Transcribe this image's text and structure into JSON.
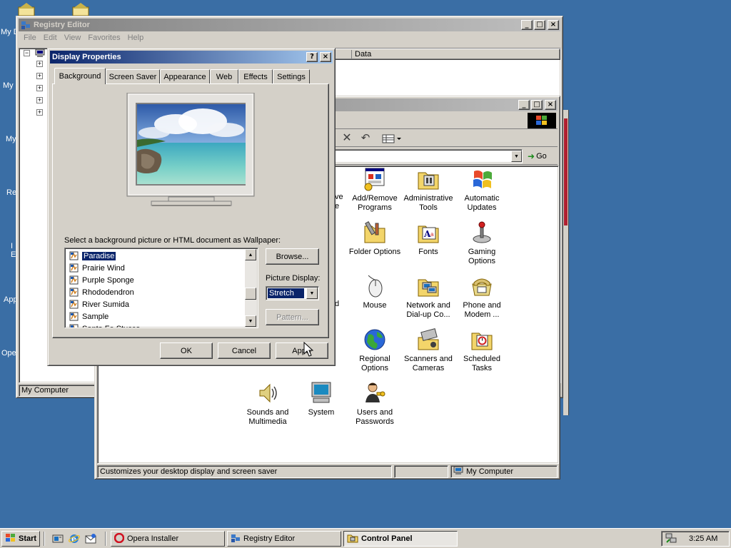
{
  "desktop": {
    "icon_labels": [
      "My D",
      "My",
      "My",
      "Re",
      "I\nE",
      "App",
      "Ope"
    ]
  },
  "registry": {
    "title": "Registry Editor",
    "menu": [
      "File",
      "Edit",
      "View",
      "Favorites",
      "Help"
    ],
    "data_header": "Data",
    "status": "My Computer"
  },
  "control_panel": {
    "go_label": "Go",
    "status_left": "Customizes your desktop display and screen saver",
    "status_right": "My Computer",
    "partial_items": [
      "ve",
      "e",
      "d"
    ],
    "items": [
      {
        "label": "Add/Remove\nPrograms",
        "icon": "add-remove-programs-icon"
      },
      {
        "label": "Administrative\nTools",
        "icon": "administrative-tools-icon"
      },
      {
        "label": "Automatic\nUpdates",
        "icon": "automatic-updates-icon"
      },
      {
        "label": "Folder Options",
        "icon": "folder-options-icon"
      },
      {
        "label": "Fonts",
        "icon": "fonts-icon"
      },
      {
        "label": "Gaming\nOptions",
        "icon": "gaming-options-icon"
      },
      {
        "label": "Mouse",
        "icon": "mouse-icon"
      },
      {
        "label": "Network and\nDial-up Co...",
        "icon": "network-icon"
      },
      {
        "label": "Phone and\nModem ...",
        "icon": "phone-modem-icon"
      },
      {
        "label": "Regional\nOptions",
        "icon": "regional-options-icon"
      },
      {
        "label": "Scanners and\nCameras",
        "icon": "scanner-icon"
      },
      {
        "label": "Scheduled\nTasks",
        "icon": "scheduled-tasks-icon"
      },
      {
        "label": "Sounds and\nMultimedia",
        "icon": "sounds-icon"
      },
      {
        "label": "System",
        "icon": "system-icon"
      },
      {
        "label": "Users and\nPasswords",
        "icon": "users-icon"
      }
    ]
  },
  "display_properties": {
    "title": "Display Properties",
    "tabs": [
      "Background",
      "Screen Saver",
      "Appearance",
      "Web",
      "Effects",
      "Settings"
    ],
    "active_tab": "Background",
    "wallpaper_prompt": "Select a background picture or HTML document as Wallpaper:",
    "wallpapers": [
      "Paradise",
      "Prairie Wind",
      "Purple Sponge",
      "Rhododendron",
      "River Sumida",
      "Sample",
      "Santa Fe Stucco"
    ],
    "selected_wallpaper": "Paradise",
    "browse_label": "Browse...",
    "picture_display_label": "Picture Display:",
    "picture_display_value": "Stretch",
    "pattern_label": "Pattern...",
    "ok_label": "OK",
    "cancel_label": "Cancel",
    "apply_label": "Apply"
  },
  "taskbar": {
    "start_label": "Start",
    "tasks": [
      "Opera Installer",
      "Registry Editor",
      "Control Panel"
    ],
    "active_task": "Control Panel",
    "clock": "3:25 AM"
  }
}
